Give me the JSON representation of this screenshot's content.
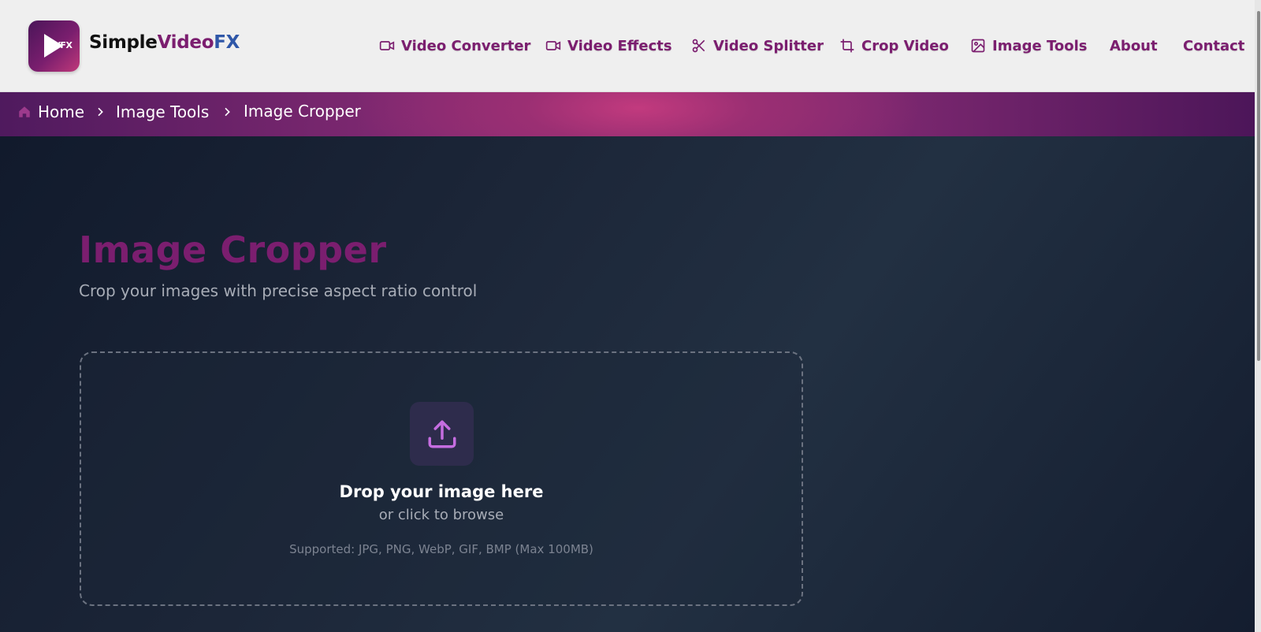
{
  "brand": {
    "logo_mini": "SVFX",
    "name_part1": "Simple",
    "name_part2": "Video",
    "name_part3": "FX"
  },
  "nav": {
    "items": [
      {
        "label": "Video Converter",
        "icon": "video-camera-icon"
      },
      {
        "label": "Video Effects",
        "icon": "video-camera-icon"
      },
      {
        "label": "Video Splitter",
        "icon": "scissors-icon"
      },
      {
        "label": "Crop Video",
        "icon": "crop-icon"
      },
      {
        "label": "Image Tools",
        "icon": "image-icon"
      },
      {
        "label": "About"
      },
      {
        "label": "Contact"
      }
    ]
  },
  "breadcrumb": {
    "items": [
      "Home",
      "Image Tools",
      "Image Cropper"
    ]
  },
  "page": {
    "title": "Image Cropper",
    "subtitle": "Crop your images with precise aspect ratio control"
  },
  "dropzone": {
    "title": "Drop your image here",
    "subtitle": "or click to browse",
    "supported": "Supported: JPG, PNG, WebP, GIF, BMP (Max 100MB)",
    "icon": "upload-icon"
  },
  "colors": {
    "accent": "#7b1e6f",
    "brand_fx": "#2f57a8",
    "upload_icon": "#c56de0"
  }
}
